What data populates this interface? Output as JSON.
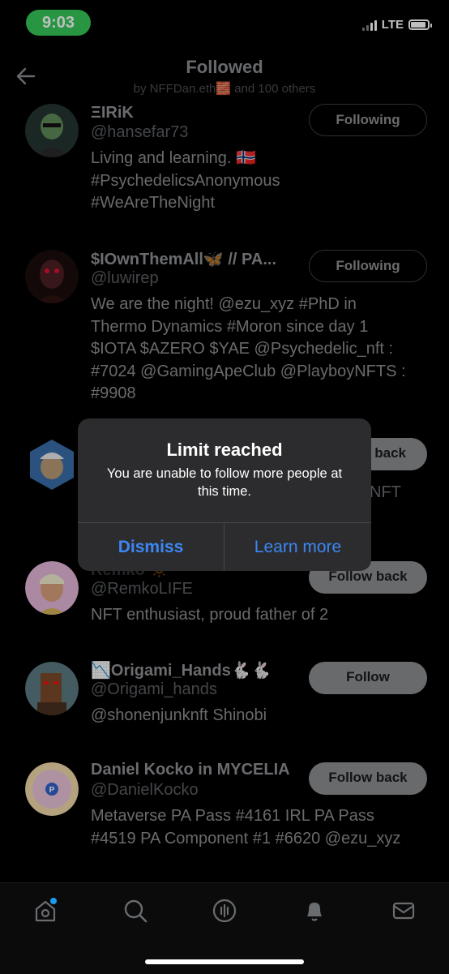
{
  "status": {
    "time": "9:03",
    "network": "LTE"
  },
  "header": {
    "title": "Followed",
    "subtitle": "by NFFDan.eth🧱 and 100 others"
  },
  "users": [
    {
      "name": "ΞIRiK",
      "handle": "@hansefar73",
      "bio": [
        "Living and learning. 🇳🇴",
        "#PsychedelicsAnonymous",
        "#WeAreTheNight"
      ],
      "button": "Following"
    },
    {
      "name": "$IOwnThemAll🦋 // PA...",
      "handle": "@luwirep",
      "bio": [
        "We are the night! @ezu_xyz #PhD in",
        "Thermo Dynamics #Moron since day 1",
        "$IOTA $AZERO $YAE @Psychedelic_nft :",
        "#7024 @GamingApeClub @PlayboyNFTS :",
        "#9908"
      ],
      "button": "Following"
    },
    {
      "name": "",
      "handle": "",
      "bio_partial": "NFT",
      "button_partial": "back"
    },
    {
      "name": "Remko 🔅",
      "handle": "@RemkoLIFE",
      "bio": [
        "NFT enthusiast, proud father of 2"
      ],
      "button": "Follow back"
    },
    {
      "name": "📉Origami_Hands🐇🐇",
      "handle": "@Origami_hands",
      "bio": [
        "@shonenjunknft Shinobi"
      ],
      "button": "Follow"
    },
    {
      "name": "Daniel Kocko in MYCELIA",
      "handle": "@DanielKocko",
      "bio": [
        "Metaverse PA Pass #4161 IRL PA Pass",
        "#4519 PA Component #1 #6620 @ezu_xyz"
      ],
      "button": "Follow back"
    }
  ],
  "dialog": {
    "title": "Limit reached",
    "message": "You are unable to follow more people at this time.",
    "dismiss": "Dismiss",
    "learn_more": "Learn more"
  },
  "tabbar": {
    "icons": [
      "home-icon",
      "search-icon",
      "spaces-icon",
      "notifications-icon",
      "messages-icon"
    ]
  }
}
